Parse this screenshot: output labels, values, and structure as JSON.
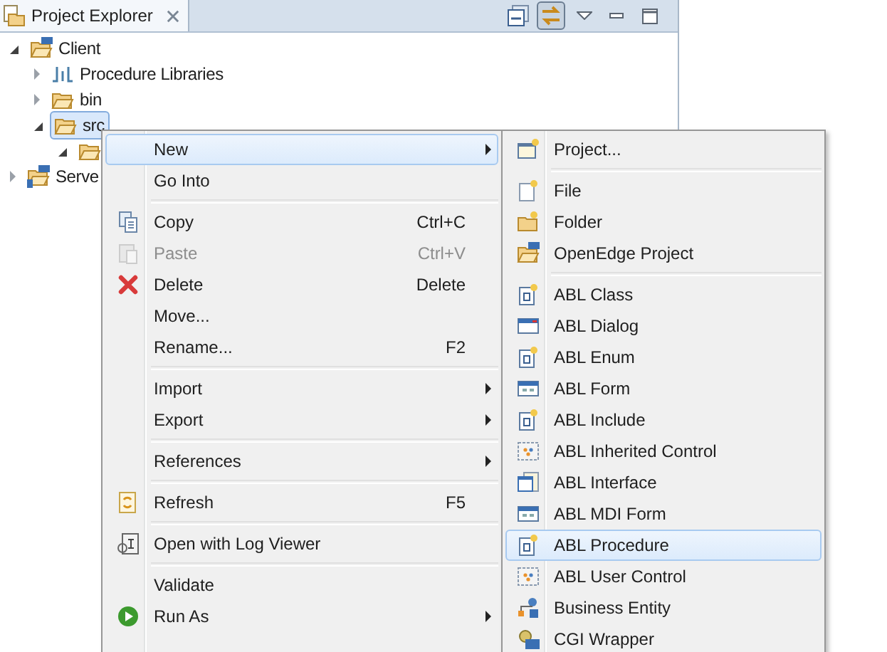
{
  "view": {
    "title": "Project Explorer",
    "toolbar": [
      {
        "kind": "collapse",
        "selected": false
      },
      {
        "kind": "link",
        "selected": true
      },
      {
        "kind": "view-menu",
        "selected": false
      },
      {
        "kind": "minimize",
        "selected": false
      },
      {
        "kind": "maximize",
        "selected": false
      }
    ]
  },
  "tree": [
    {
      "label": "Client",
      "kind": "project",
      "expanded": true,
      "selected": false,
      "children": [
        {
          "label": "Procedure Libraries",
          "kind": "library",
          "expanded": false,
          "selected": false
        },
        {
          "label": "bin",
          "kind": "folder",
          "expanded": false,
          "selected": false
        },
        {
          "label": "src",
          "kind": "folder",
          "expanded": true,
          "selected": true,
          "children": [
            {
              "kind": "folder",
              "expanded": true,
              "selected": false
            }
          ]
        }
      ]
    },
    {
      "label": "Serve",
      "kind": "server-project",
      "expanded": false,
      "selected": false
    }
  ],
  "context_menu": [
    {
      "kind": "plain",
      "label": "New",
      "submenu": true,
      "selected": true,
      "disabled": false
    },
    {
      "kind": "plain",
      "label": "Go Into",
      "selected": false,
      "disabled": false
    },
    {
      "kind": "separator"
    },
    {
      "kind": "copy",
      "label": "Copy",
      "shortcut": "Ctrl+C",
      "selected": false,
      "disabled": false
    },
    {
      "kind": "paste",
      "label": "Paste",
      "shortcut": "Ctrl+V",
      "selected": false,
      "disabled": true
    },
    {
      "kind": "delete",
      "label": "Delete",
      "shortcut": "Delete",
      "selected": false,
      "disabled": false
    },
    {
      "kind": "plain",
      "label": "Move...",
      "selected": false,
      "disabled": false
    },
    {
      "kind": "plain",
      "label": "Rename...",
      "shortcut": "F2",
      "selected": false,
      "disabled": false
    },
    {
      "kind": "separator"
    },
    {
      "kind": "plain",
      "label": "Import",
      "submenu": true,
      "selected": false,
      "disabled": false
    },
    {
      "kind": "plain",
      "label": "Export",
      "submenu": true,
      "selected": false,
      "disabled": false
    },
    {
      "kind": "separator"
    },
    {
      "kind": "plain",
      "label": "References",
      "submenu": true,
      "selected": false,
      "disabled": false
    },
    {
      "kind": "separator"
    },
    {
      "kind": "refresh",
      "label": "Refresh",
      "shortcut": "F5",
      "selected": false,
      "disabled": false
    },
    {
      "kind": "separator"
    },
    {
      "kind": "log",
      "label": "Open with Log Viewer",
      "selected": false,
      "disabled": false
    },
    {
      "kind": "separator"
    },
    {
      "kind": "plain",
      "label": "Validate",
      "selected": false,
      "disabled": false
    },
    {
      "kind": "run",
      "label": "Run As",
      "submenu": true,
      "selected": false,
      "disabled": false
    }
  ],
  "new_submenu": [
    {
      "kind": "new-project",
      "label": "Project...",
      "selected": false
    },
    {
      "kind": "separator"
    },
    {
      "kind": "new-file",
      "label": "File",
      "selected": false
    },
    {
      "kind": "new-folder",
      "label": "Folder",
      "selected": false
    },
    {
      "kind": "project",
      "label": "OpenEdge Project",
      "selected": false
    },
    {
      "kind": "separator"
    },
    {
      "kind": "letter-file",
      "label": "ABL Class",
      "selected": false
    },
    {
      "kind": "dialog",
      "label": "ABL Dialog",
      "selected": false
    },
    {
      "kind": "letter-file",
      "label": "ABL Enum",
      "selected": false
    },
    {
      "kind": "form",
      "label": "ABL Form",
      "selected": false
    },
    {
      "kind": "letter-file",
      "label": "ABL Include",
      "selected": false
    },
    {
      "kind": "control",
      "label": "ABL Inherited Control",
      "selected": false
    },
    {
      "kind": "interface",
      "label": "ABL Interface",
      "selected": false
    },
    {
      "kind": "form",
      "label": "ABL MDI Form",
      "selected": false
    },
    {
      "kind": "letter-file",
      "label": "ABL Procedure",
      "selected": true
    },
    {
      "kind": "control",
      "label": "ABL User Control",
      "selected": false
    },
    {
      "kind": "entity",
      "label": "Business Entity",
      "selected": false
    },
    {
      "kind": "wrapper",
      "label": "CGI Wrapper",
      "selected": false
    }
  ]
}
